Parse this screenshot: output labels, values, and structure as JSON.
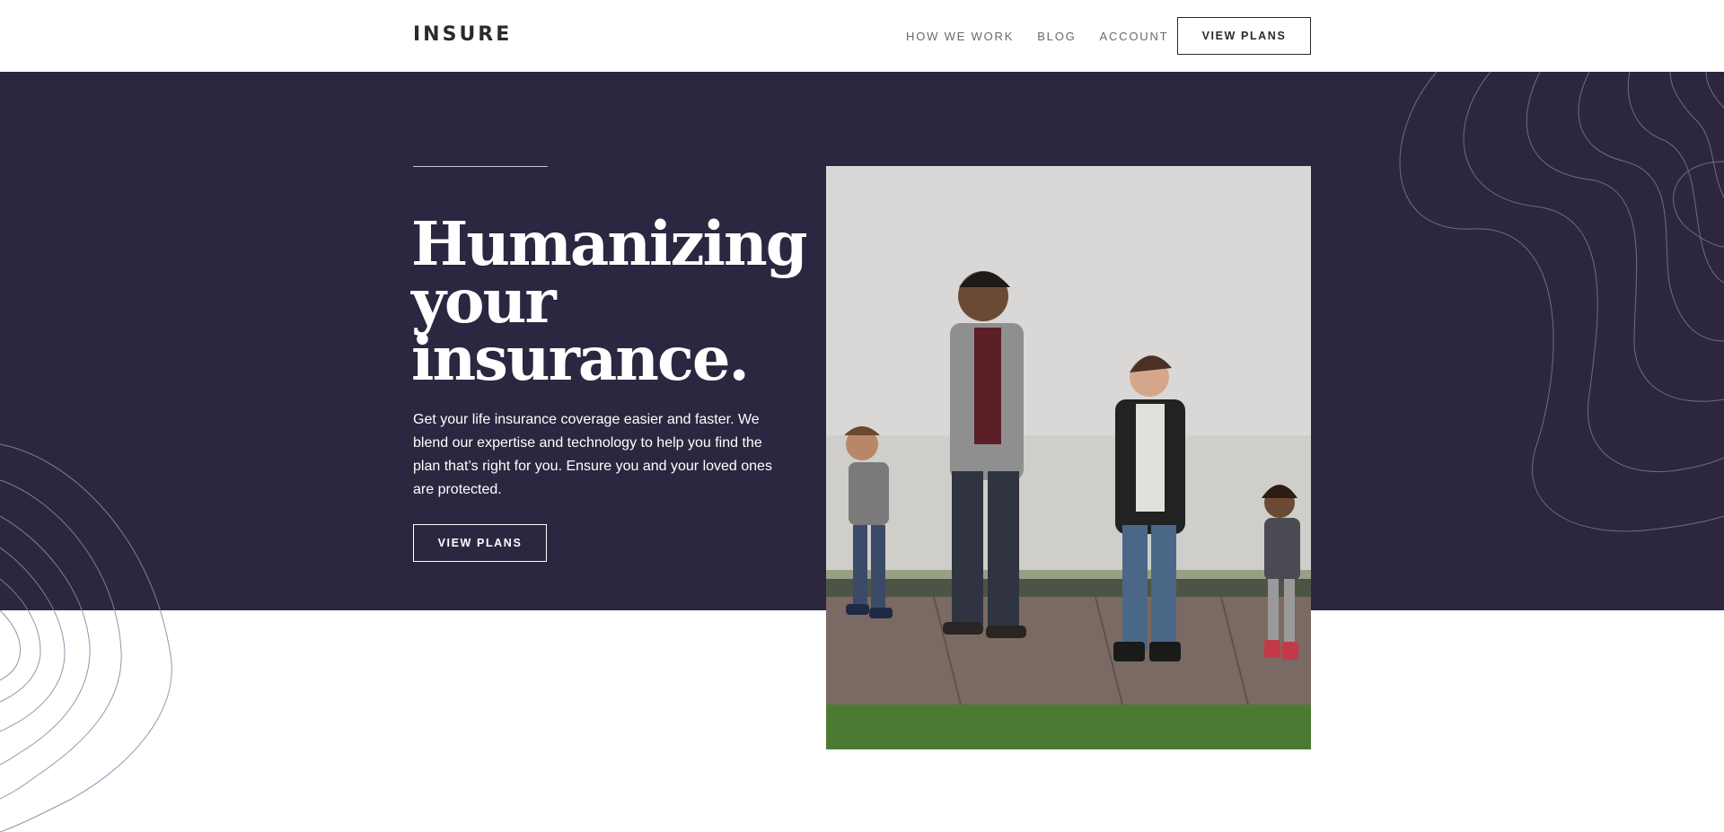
{
  "header": {
    "logo": "INSURE",
    "nav": [
      {
        "label": "HOW WE WORK"
      },
      {
        "label": "BLOG"
      },
      {
        "label": "ACCOUNT"
      }
    ],
    "cta_label": "VIEW PLANS"
  },
  "hero": {
    "title": "Humanizing your insurance.",
    "text": "Get your life insurance coverage easier and faster. We blend our expertise and technology to help you find the plan that’s right for you. Ensure you and your loved ones are protected.",
    "cta_label": "VIEW PLANS",
    "image_alt": "family-walking-photo"
  },
  "colors": {
    "hero_bg": "#2c2640",
    "text_dark": "#2c2830",
    "nav_text": "#6b6672",
    "line_purple": "#b8a9d9"
  }
}
